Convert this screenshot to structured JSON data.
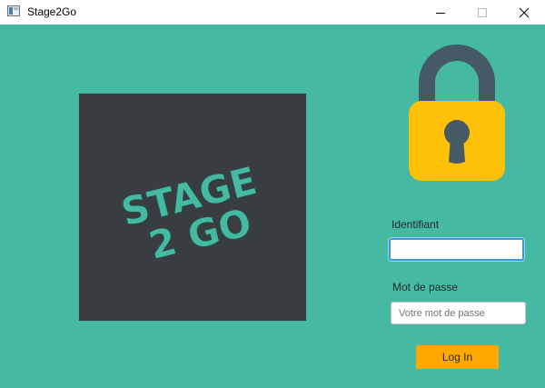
{
  "window": {
    "title": "Stage2Go",
    "app_icon": "app-window-icon",
    "controls": [
      "minimize-icon",
      "maximize-icon",
      "close-icon"
    ]
  },
  "logo": {
    "line1": "STAGE",
    "line2": "2 GO",
    "background": "#373d40",
    "text_color": "#45b9a2"
  },
  "lock_icon": {
    "name": "padlock-icon",
    "body_color": "#ffc107",
    "shackle_color": "#455a64"
  },
  "form": {
    "username_label": "Identifiant",
    "username_value": "",
    "password_label": "Mot de passe",
    "password_placeholder": "Votre mot de passe",
    "login_label": "Log In"
  },
  "colors": {
    "background": "#45b9a2",
    "button": "#ffa900",
    "focus": "#3a99d8"
  }
}
